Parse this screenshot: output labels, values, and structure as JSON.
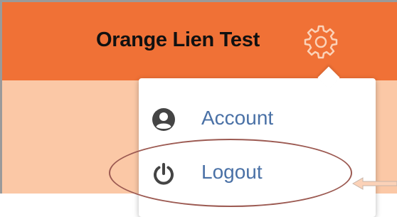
{
  "header": {
    "title": "Orange Lien Test",
    "gear_icon": "gear-icon"
  },
  "dropdown": {
    "items": [
      {
        "label": "Account",
        "icon": "user-circle-icon"
      },
      {
        "label": "Logout",
        "icon": "power-icon"
      }
    ]
  },
  "annotation": {
    "highlight": "ellipse-around-logout",
    "pointer": "arrow-pointing-left"
  },
  "colors": {
    "header_bg": "#f07136",
    "body_bg": "#fbc8a6",
    "menu_text": "#4a71a6",
    "menu_icon": "#444444",
    "annotation_stroke": "#9c5a52"
  }
}
